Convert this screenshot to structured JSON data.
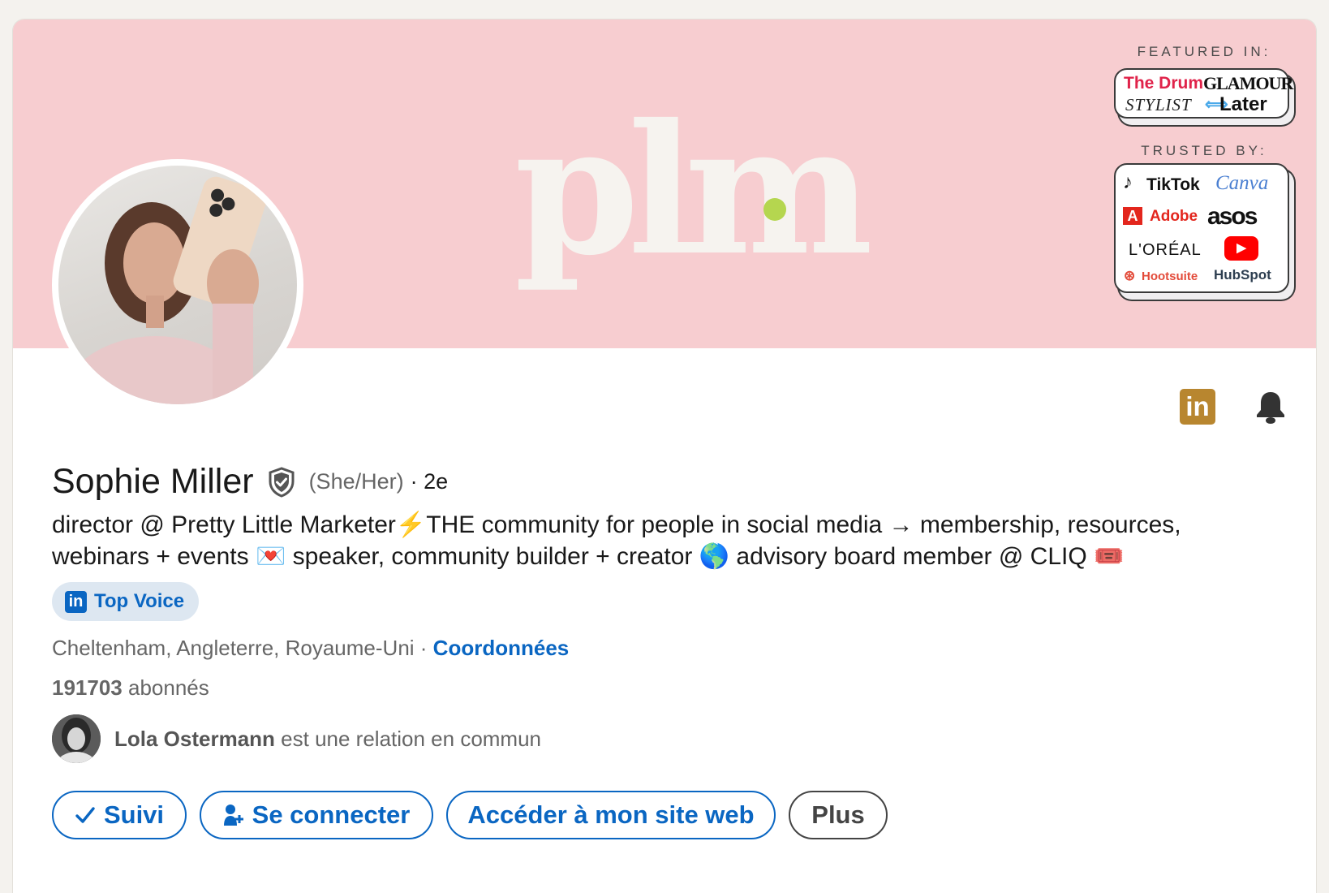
{
  "banner": {
    "logo_text": "plm",
    "featured_label": "FEATURED IN:",
    "trusted_label": "TRUSTED BY:",
    "featured_brands": [
      "The Drum",
      "GLAMOUR",
      "STYLIST",
      "Later"
    ],
    "trusted_brands": [
      "TikTok",
      "Canva",
      "Adobe",
      "asos",
      "L'ORÉAL",
      "Hootsuite",
      "HubSpot"
    ],
    "background_color": "#f7cdd0",
    "accent_dot_color": "#b5d64f"
  },
  "profile": {
    "name": "Sophie Miller",
    "pronouns": "(She/Her)",
    "degree": "· 2e",
    "headline_line1": "director @ Pretty Little Marketer⚡THE community for people in social media → membership, resources,",
    "headline_line2": "webinars + events 💌 speaker, community builder + creator 🌎 advisory board member @ CLIQ 🎟️",
    "badge_label": "Top Voice",
    "location": "Cheltenham, Angleterre, Royaume-Uni",
    "location_separator": " · ",
    "contact_link": "Coordonnées",
    "followers_count": "191703",
    "followers_label": " abonnés",
    "mutual_name": "Lola Ostermann",
    "mutual_text": " est une relation en commun"
  },
  "actions": {
    "follow_label": "Suivi",
    "connect_label": "Se connecter",
    "website_label": "Accéder à mon site web",
    "more_label": "Plus"
  },
  "icons": {
    "linkedin_icon": "linkedin-logo",
    "bell_icon": "bell",
    "verified_icon": "shield-check",
    "top_voice_icon": "linkedin-logo",
    "follow_icon": "check",
    "connect_icon": "person-add"
  },
  "colors": {
    "primary_blue": "#0a66c2",
    "linkedin_gold": "#b8862f",
    "badge_bg": "#dde7f1"
  }
}
